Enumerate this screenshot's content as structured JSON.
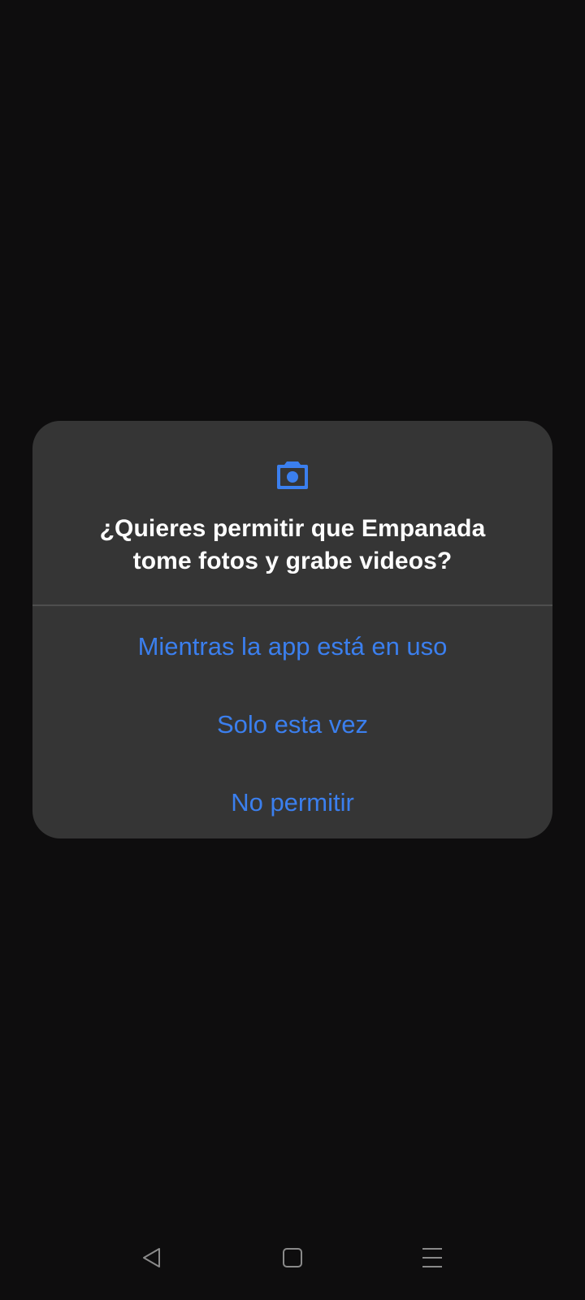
{
  "dialog": {
    "icon": "camera-icon",
    "title_line1": "¿Quieres permitir que Empanada",
    "title_line2": "tome fotos y grabe videos?",
    "options": [
      {
        "label": "Mientras la app está en uso"
      },
      {
        "label": "Solo esta vez"
      },
      {
        "label": "No permitir"
      }
    ]
  },
  "navigation": {
    "back_icon": "back-triangle-icon",
    "home_icon": "home-square-icon",
    "menu_icon": "menu-lines-icon"
  },
  "colors": {
    "background": "#0e0d0e",
    "dialog_background": "#353535",
    "accent": "#3b7fee",
    "title": "#ffffff",
    "nav_icon": "#8a8a8a"
  }
}
